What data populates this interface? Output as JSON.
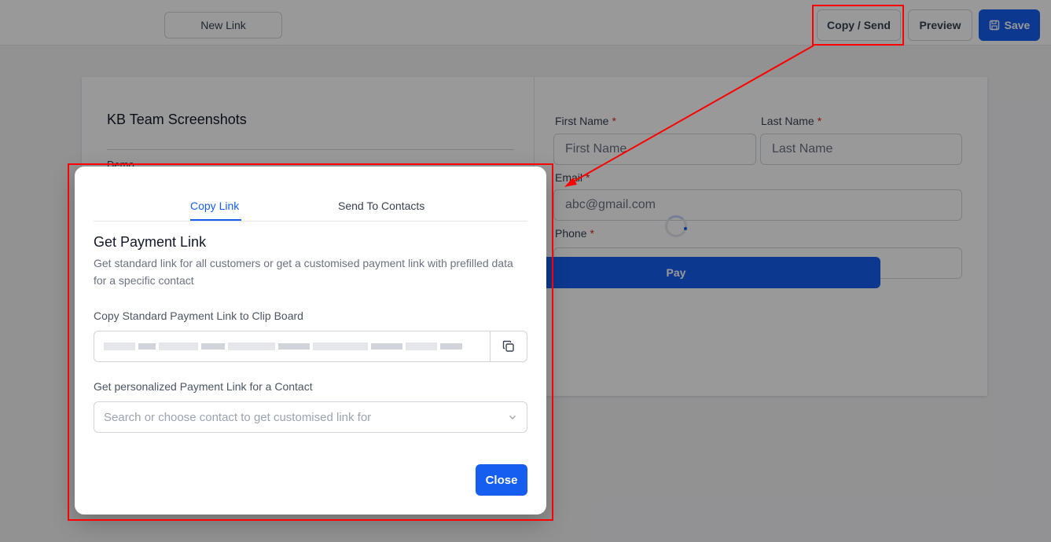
{
  "topbar": {
    "new_link": "New Link",
    "copy_send": "Copy / Send",
    "preview": "Preview",
    "save": "Save"
  },
  "card": {
    "title": "KB Team Screenshots",
    "subtitle": "Demo",
    "form": {
      "first_name_label": "First Name",
      "last_name_label": "Last Name",
      "email_label": "Email",
      "phone_label": "Phone",
      "required_mark": "*",
      "first_name_placeholder": "First Name",
      "last_name_placeholder": "Last Name",
      "email_value": "abc@gmail.com",
      "pay_button": "Pay"
    }
  },
  "modal": {
    "tabs": [
      {
        "label": "Copy Link",
        "active": true
      },
      {
        "label": "Send To Contacts",
        "active": false
      }
    ],
    "title": "Get Payment Link",
    "description": "Get standard link for all customers or get a customised payment link with prefilled data for a specific contact",
    "standard_link_label": "Copy Standard Payment Link to Clip Board",
    "personalized_label": "Get personalized Payment Link for a Contact",
    "contact_placeholder": "Search or choose contact to get customised link for",
    "close_button": "Close"
  },
  "colors": {
    "primary": "#155eef",
    "required": "#dc2626",
    "annotation": "#ff0000"
  }
}
